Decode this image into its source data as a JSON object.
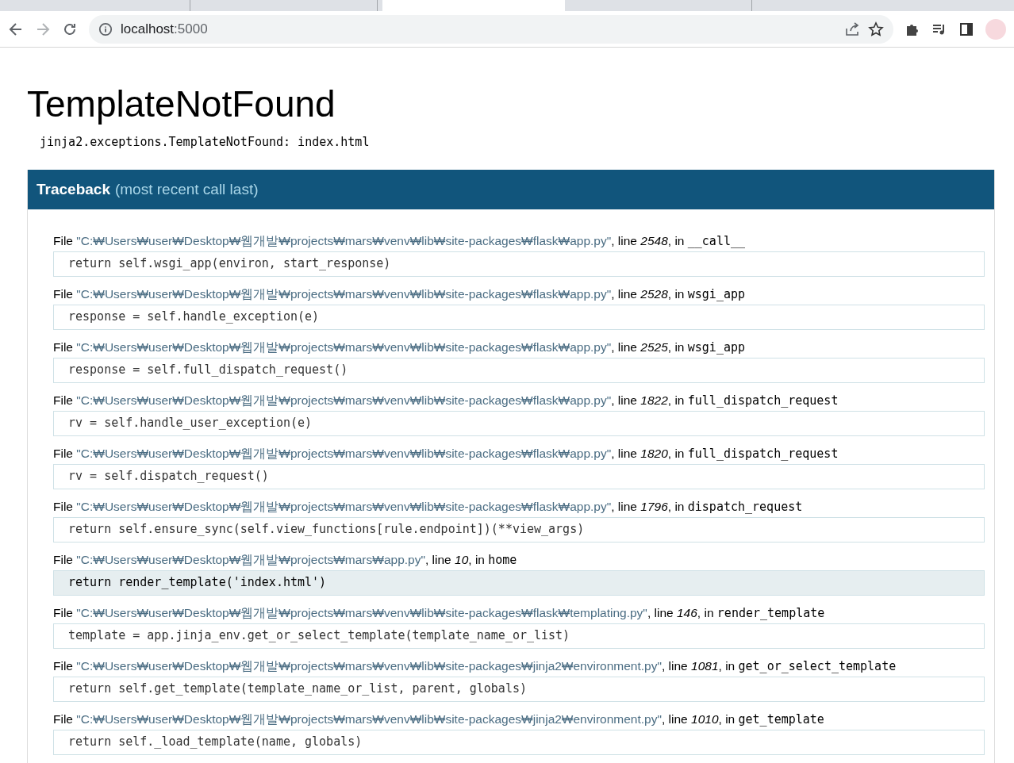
{
  "browser": {
    "tabs": [
      {
        "selected": false
      },
      {
        "selected": false
      },
      {
        "selected": true
      },
      {
        "selected": false
      }
    ],
    "address": {
      "host": "localhost",
      "port": ":5000"
    }
  },
  "error": {
    "title": "TemplateNotFound",
    "message": "jinja2.exceptions.TemplateNotFound: index.html"
  },
  "traceback": {
    "heading": "Traceback",
    "subheading": "(most recent call last)",
    "frames": [
      {
        "file_word": "File",
        "file": "\"C:₩Users₩user₩Desktop₩웹개발₩projects₩mars₩venv₩lib₩site-packages₩flask₩app.py\"",
        "line_word": ", line",
        "line": "2548",
        "in_word": ", in",
        "function": "__call__",
        "code": "return self.wsgi_app(environ, start_response)",
        "current": false
      },
      {
        "file_word": "File",
        "file": "\"C:₩Users₩user₩Desktop₩웹개발₩projects₩mars₩venv₩lib₩site-packages₩flask₩app.py\"",
        "line_word": ", line",
        "line": "2528",
        "in_word": ", in",
        "function": "wsgi_app",
        "code": "response = self.handle_exception(e)",
        "current": false
      },
      {
        "file_word": "File",
        "file": "\"C:₩Users₩user₩Desktop₩웹개발₩projects₩mars₩venv₩lib₩site-packages₩flask₩app.py\"",
        "line_word": ", line",
        "line": "2525",
        "in_word": ", in",
        "function": "wsgi_app",
        "code": "response = self.full_dispatch_request()",
        "current": false
      },
      {
        "file_word": "File",
        "file": "\"C:₩Users₩user₩Desktop₩웹개발₩projects₩mars₩venv₩lib₩site-packages₩flask₩app.py\"",
        "line_word": ", line",
        "line": "1822",
        "in_word": ", in",
        "function": "full_dispatch_request",
        "code": "rv = self.handle_user_exception(e)",
        "current": false
      },
      {
        "file_word": "File",
        "file": "\"C:₩Users₩user₩Desktop₩웹개발₩projects₩mars₩venv₩lib₩site-packages₩flask₩app.py\"",
        "line_word": ", line",
        "line": "1820",
        "in_word": ", in",
        "function": "full_dispatch_request",
        "code": "rv = self.dispatch_request()",
        "current": false
      },
      {
        "file_word": "File",
        "file": "\"C:₩Users₩user₩Desktop₩웹개발₩projects₩mars₩venv₩lib₩site-packages₩flask₩app.py\"",
        "line_word": ", line",
        "line": "1796",
        "in_word": ", in",
        "function": "dispatch_request",
        "code": "return self.ensure_sync(self.view_functions[rule.endpoint])(**view_args)",
        "current": false
      },
      {
        "file_word": "File",
        "file": "\"C:₩Users₩user₩Desktop₩웹개발₩projects₩mars₩app.py\"",
        "line_word": ", line",
        "line": "10",
        "in_word": ", in",
        "function": "home",
        "code": "return render_template('index.html')",
        "current": true
      },
      {
        "file_word": "File",
        "file": "\"C:₩Users₩user₩Desktop₩웹개발₩projects₩mars₩venv₩lib₩site-packages₩flask₩templating.py\"",
        "line_word": ", line",
        "line": "146",
        "in_word": ", in",
        "function": "render_template",
        "code": "template = app.jinja_env.get_or_select_template(template_name_or_list)",
        "current": false
      },
      {
        "file_word": "File",
        "file": "\"C:₩Users₩user₩Desktop₩웹개발₩projects₩mars₩venv₩lib₩site-packages₩jinja2₩environment.py\"",
        "line_word": ", line",
        "line": "1081",
        "in_word": ", in",
        "function": "get_or_select_template",
        "code": "return self.get_template(template_name_or_list, parent, globals)",
        "current": false
      },
      {
        "file_word": "File",
        "file": "\"C:₩Users₩user₩Desktop₩웹개발₩projects₩mars₩venv₩lib₩site-packages₩jinja2₩environment.py\"",
        "line_word": ", line",
        "line": "1010",
        "in_word": ", in",
        "function": "get_template",
        "code": "return self._load_template(name, globals)",
        "current": false
      }
    ]
  }
}
